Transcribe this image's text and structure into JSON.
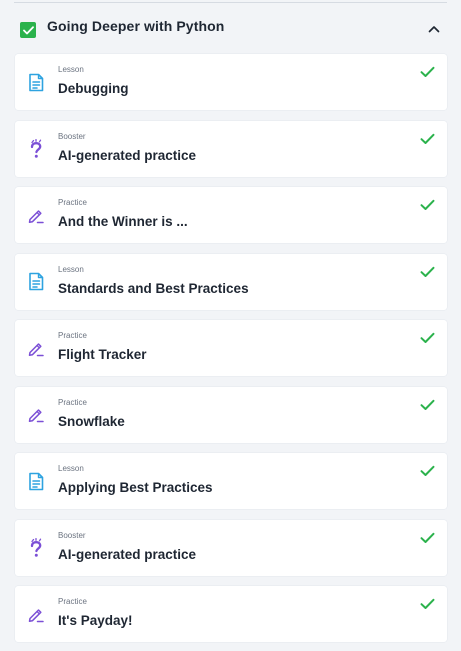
{
  "section": {
    "title": "Going Deeper with Python",
    "completed": true,
    "expanded": true,
    "check_icon": "check-icon",
    "collapse_icon": "chevron-up-icon"
  },
  "colors": {
    "complete_green": "#2bb24c",
    "lesson_blue": "#2ea3e0",
    "practice_purple": "#7b4fd6",
    "booster_purple": "#7b4fd6",
    "text_dark": "#1f2733",
    "text_muted": "#6b7380"
  },
  "items": [
    {
      "type": "Lesson",
      "title": "Debugging",
      "icon": "lesson-document-icon",
      "completed": true
    },
    {
      "type": "Booster",
      "title": "AI-generated practice",
      "icon": "question-mark-icon",
      "completed": true
    },
    {
      "type": "Practice",
      "title": "And the Winner is ...",
      "icon": "pencil-icon",
      "completed": true
    },
    {
      "type": "Lesson",
      "title": "Standards and Best Practices",
      "icon": "lesson-document-icon",
      "completed": true
    },
    {
      "type": "Practice",
      "title": "Flight Tracker",
      "icon": "pencil-icon",
      "completed": true
    },
    {
      "type": "Practice",
      "title": "Snowflake",
      "icon": "pencil-icon",
      "completed": true
    },
    {
      "type": "Lesson",
      "title": "Applying Best Practices",
      "icon": "lesson-document-icon",
      "completed": true
    },
    {
      "type": "Booster",
      "title": "AI-generated practice",
      "icon": "question-mark-icon",
      "completed": true
    },
    {
      "type": "Practice",
      "title": "It's Payday!",
      "icon": "pencil-icon",
      "completed": true
    }
  ]
}
